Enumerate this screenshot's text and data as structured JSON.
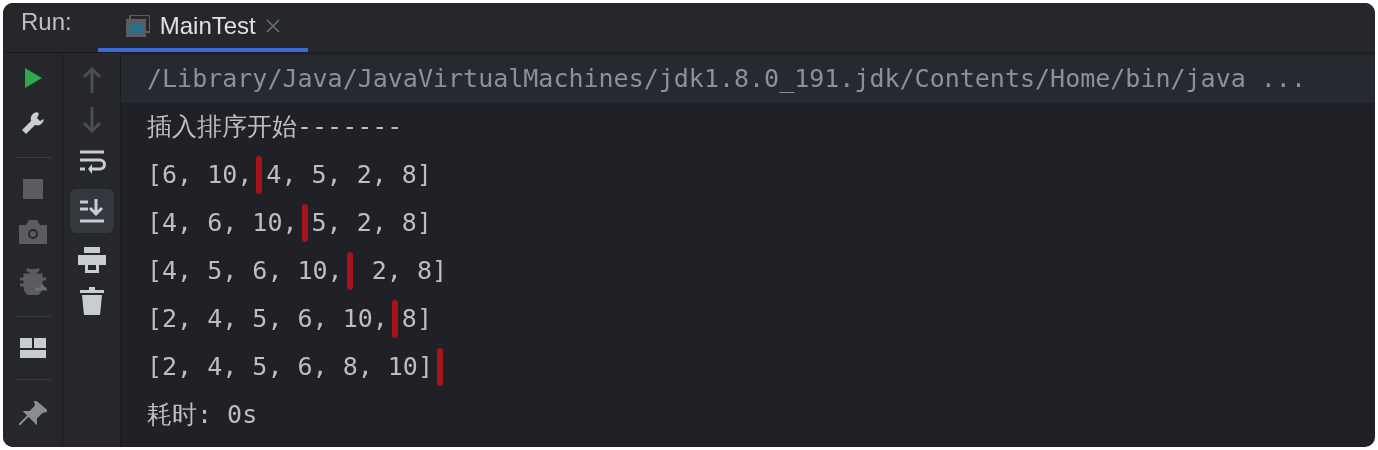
{
  "header": {
    "label": "Run:",
    "tabs": [
      {
        "label": "MainTest",
        "selected": true
      }
    ]
  },
  "console": {
    "lines": [
      {
        "kind": "command",
        "text": "/Library/Java/JavaVirtualMachines/jdk1.8.0_191.jdk/Contents/Home/bin/java ..."
      },
      {
        "kind": "output",
        "text": "插入排序开始-------"
      },
      {
        "kind": "marked",
        "before": "[6, 10,",
        "after": "4, 5, 2, 8]"
      },
      {
        "kind": "marked",
        "before": "[4, 6, 10,",
        "after": "5, 2, 8]"
      },
      {
        "kind": "marked",
        "before": "[4, 5, 6, 10,",
        "after": " 2, 8]"
      },
      {
        "kind": "marked",
        "before": "[2, 4, 5, 6, 10,",
        "after": "8]"
      },
      {
        "kind": "marked",
        "before": "[2, 4, 5, 6, 8, 10]"
      },
      {
        "kind": "output",
        "text": "耗时: 0s"
      }
    ]
  }
}
